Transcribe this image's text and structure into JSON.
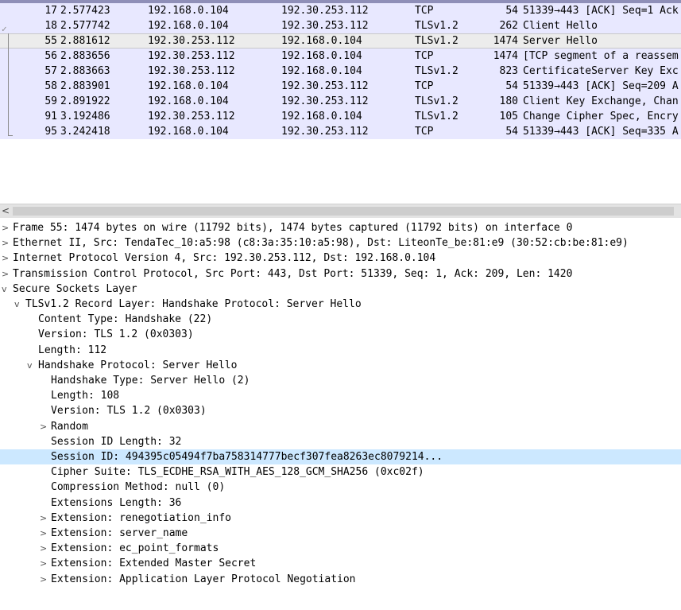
{
  "packets": [
    {
      "no": "17",
      "time": "2.577423",
      "src": "192.168.0.104",
      "dst": "192.30.253.112",
      "proto": "TCP",
      "len": "54",
      "info": "51339→443 [ACK] Seq=1 Ack"
    },
    {
      "no": "18",
      "time": "2.577742",
      "src": "192.168.0.104",
      "dst": "192.30.253.112",
      "proto": "TLSv1.2",
      "len": "262",
      "info": "Client Hello"
    },
    {
      "no": "55",
      "time": "2.881612",
      "src": "192.30.253.112",
      "dst": "192.168.0.104",
      "proto": "TLSv1.2",
      "len": "1474",
      "info": "Server Hello"
    },
    {
      "no": "56",
      "time": "2.883656",
      "src": "192.30.253.112",
      "dst": "192.168.0.104",
      "proto": "TCP",
      "len": "1474",
      "info": "[TCP segment of a reassem"
    },
    {
      "no": "57",
      "time": "2.883663",
      "src": "192.30.253.112",
      "dst": "192.168.0.104",
      "proto": "TLSv1.2",
      "len": "823",
      "info": "CertificateServer Key Exc"
    },
    {
      "no": "58",
      "time": "2.883901",
      "src": "192.168.0.104",
      "dst": "192.30.253.112",
      "proto": "TCP",
      "len": "54",
      "info": "51339→443 [ACK] Seq=209 A"
    },
    {
      "no": "59",
      "time": "2.891922",
      "src": "192.168.0.104",
      "dst": "192.30.253.112",
      "proto": "TLSv1.2",
      "len": "180",
      "info": "Client Key Exchange, Chan"
    },
    {
      "no": "91",
      "time": "3.192486",
      "src": "192.30.253.112",
      "dst": "192.168.0.104",
      "proto": "TLSv1.2",
      "len": "105",
      "info": "Change Cipher Spec, Encry"
    },
    {
      "no": "95",
      "time": "3.242418",
      "src": "192.168.0.104",
      "dst": "192.30.253.112",
      "proto": "TCP",
      "len": "54",
      "info": "51339→443 [ACK] Seq=335 A"
    }
  ],
  "selected_packet": "55",
  "scrollbar": {
    "left_arrow": "<"
  },
  "details": [
    {
      "toggle": ">",
      "text": "Frame 55: 1474 bytes on wire (11792 bits), 1474 bytes captured (11792 bits) on interface 0"
    },
    {
      "toggle": ">",
      "text": "Ethernet II, Src: TendaTec_10:a5:98 (c8:3a:35:10:a5:98), Dst: LiteonTe_be:81:e9 (30:52:cb:be:81:e9)"
    },
    {
      "toggle": ">",
      "text": "Internet Protocol Version 4, Src: 192.30.253.112, Dst: 192.168.0.104"
    },
    {
      "toggle": ">",
      "text": "Transmission Control Protocol, Src Port: 443, Dst Port: 51339, Seq: 1, Ack: 209, Len: 1420"
    },
    {
      "toggle": "v",
      "text": "Secure Sockets Layer"
    },
    {
      "toggle": "v",
      "text": "TLSv1.2 Record Layer: Handshake Protocol: Server Hello"
    },
    {
      "toggle": "",
      "text": "Content Type: Handshake (22)"
    },
    {
      "toggle": "",
      "text": "Version: TLS 1.2 (0x0303)"
    },
    {
      "toggle": "",
      "text": "Length: 112"
    },
    {
      "toggle": "v",
      "text": "Handshake Protocol: Server Hello"
    },
    {
      "toggle": "",
      "text": "Handshake Type: Server Hello (2)"
    },
    {
      "toggle": "",
      "text": "Length: 108"
    },
    {
      "toggle": "",
      "text": "Version: TLS 1.2 (0x0303)"
    },
    {
      "toggle": ">",
      "text": "Random"
    },
    {
      "toggle": "",
      "text": "Session ID Length: 32"
    },
    {
      "toggle": "",
      "text": "Session ID: 494395c05494f7ba758314777becf307fea8263ec8079214..."
    },
    {
      "toggle": "",
      "text": "Cipher Suite: TLS_ECDHE_RSA_WITH_AES_128_GCM_SHA256 (0xc02f)"
    },
    {
      "toggle": "",
      "text": "Compression Method: null (0)"
    },
    {
      "toggle": "",
      "text": "Extensions Length: 36"
    },
    {
      "toggle": ">",
      "text": "Extension: renegotiation_info"
    },
    {
      "toggle": ">",
      "text": "Extension: server_name"
    },
    {
      "toggle": ">",
      "text": "Extension: ec_point_formats"
    },
    {
      "toggle": ">",
      "text": "Extension: Extended Master Secret"
    },
    {
      "toggle": ">",
      "text": "Extension: Application Layer Protocol Negotiation"
    }
  ],
  "highlighted_detail": "Session ID: 494395c05494f7ba758314777becf307fea8263ec8079214...",
  "colors": {
    "packet_row_bg": "#e8e8ff",
    "selected_row_bg": "#ececec",
    "detail_highlight": "#cce8ff"
  }
}
